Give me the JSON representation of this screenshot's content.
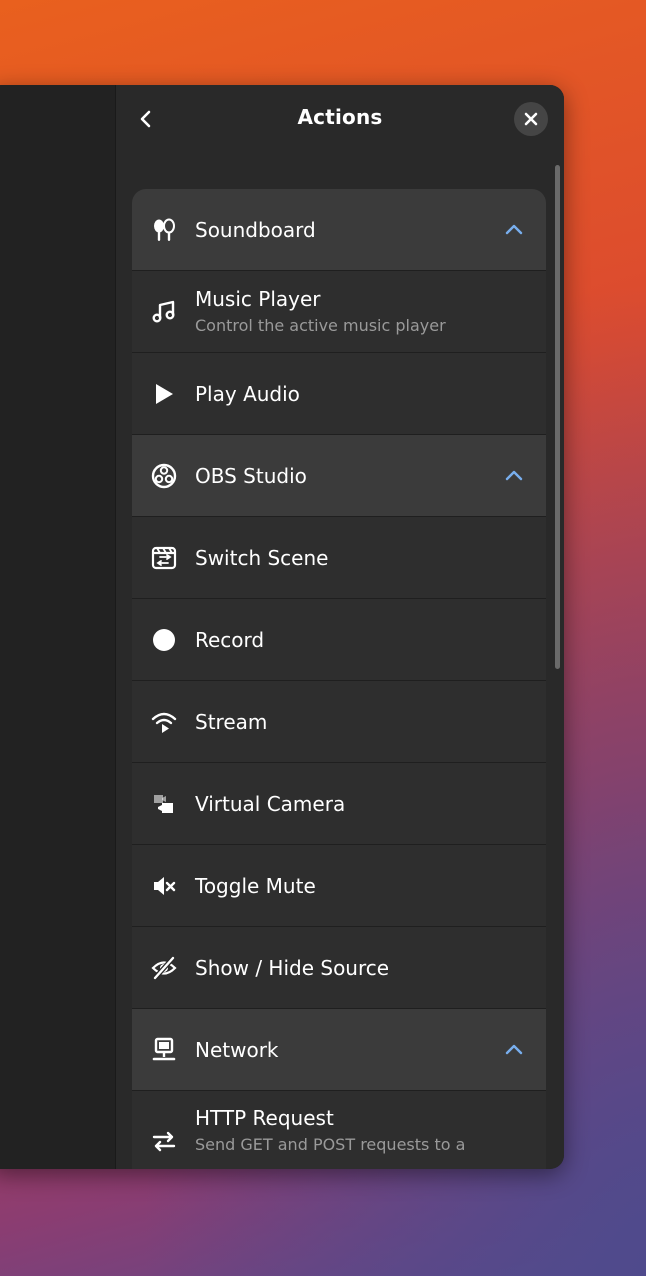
{
  "header": {
    "title": "Actions",
    "back_icon": "chevron-left-icon",
    "close_icon": "close-icon"
  },
  "categories": [
    {
      "label": "Soundboard",
      "icon": "soundboard-icon",
      "expanded": true,
      "items": [
        {
          "label": "Music Player",
          "subtitle": "Control the active music player",
          "icon": "music-note-icon"
        },
        {
          "label": "Play Audio",
          "icon": "play-icon"
        }
      ]
    },
    {
      "label": "OBS Studio",
      "icon": "obs-logo-icon",
      "expanded": true,
      "items": [
        {
          "label": "Switch Scene",
          "icon": "switch-scene-icon"
        },
        {
          "label": "Record",
          "icon": "record-icon"
        },
        {
          "label": "Stream",
          "icon": "stream-icon"
        },
        {
          "label": "Virtual Camera",
          "icon": "virtual-camera-icon"
        },
        {
          "label": "Toggle Mute",
          "icon": "mute-icon"
        },
        {
          "label": "Show / Hide Source",
          "icon": "eye-hidden-icon"
        }
      ]
    },
    {
      "label": "Network",
      "icon": "network-icon",
      "expanded": true,
      "items": [
        {
          "label": "HTTP Request",
          "subtitle": "Send GET and POST requests to a",
          "icon": "arrows-exchange-icon"
        }
      ]
    }
  ],
  "colors": {
    "accent": "#78aeed",
    "panel_bg": "#292929",
    "row_bg": "#2e2e2e",
    "category_bg": "#3b3b3b"
  }
}
